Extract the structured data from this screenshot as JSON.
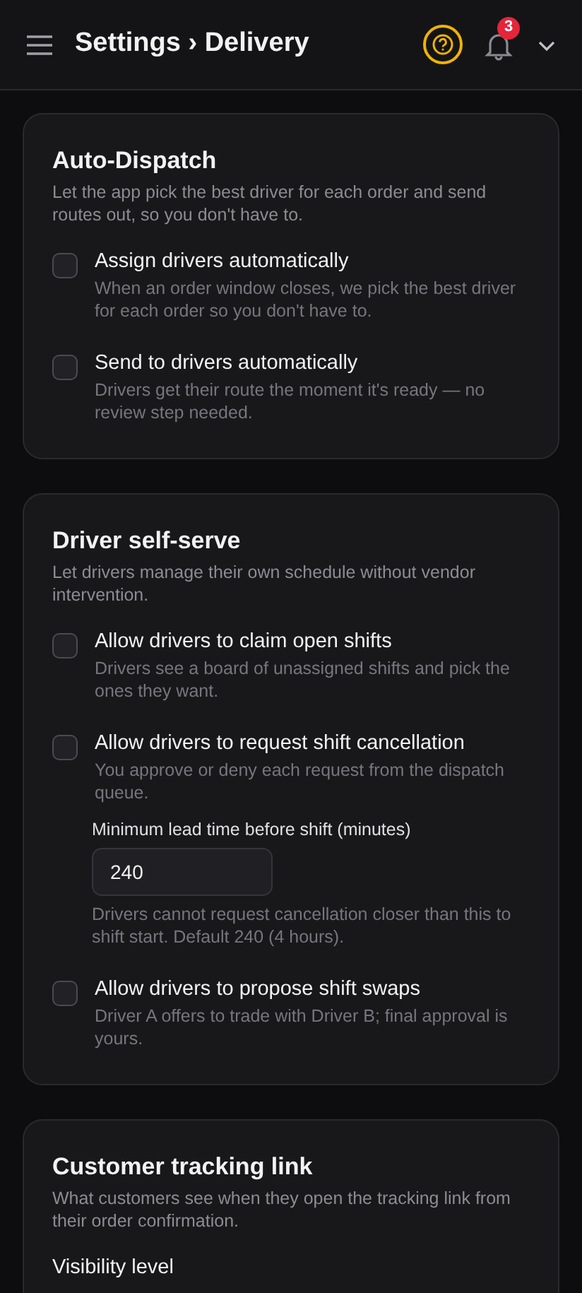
{
  "header": {
    "title": "Settings › Delivery",
    "notification_count": "3"
  },
  "sections": [
    {
      "title": "Auto-Dispatch",
      "description": "Let the app pick the best driver for each order and send routes out, so you don't have to.",
      "items": [
        {
          "kind": "checkbox",
          "label": "Assign drivers automatically",
          "hint": "When an order window closes, we pick the best driver for each order so you don't have to.",
          "checked": false
        },
        {
          "kind": "checkbox",
          "label": "Send to drivers automatically",
          "hint": "Drivers get their route the moment it's ready — no review step needed.",
          "checked": false
        }
      ]
    },
    {
      "title": "Driver self-serve",
      "description": "Let drivers manage their own schedule without vendor intervention.",
      "items": [
        {
          "kind": "checkbox",
          "label": "Allow drivers to claim open shifts",
          "hint": "Drivers see a board of unassigned shifts and pick the ones they want.",
          "checked": false
        },
        {
          "kind": "checkbox",
          "label": "Allow drivers to request shift cancellation",
          "hint": "You approve or deny each request from the dispatch queue.",
          "checked": false
        },
        {
          "kind": "number_field",
          "label": "Minimum lead time before shift (minutes)",
          "value": "240",
          "hint": "Drivers cannot request cancellation closer than this to shift start. Default 240 (4 hours)."
        },
        {
          "kind": "checkbox",
          "label": "Allow drivers to propose shift swaps",
          "hint": "Driver A offers to trade with Driver B; final approval is yours.",
          "checked": false
        }
      ]
    },
    {
      "title": "Customer tracking link",
      "description": "What customers see when they open the tracking link from their order confirmation.",
      "items": [
        {
          "kind": "field_label",
          "label": "Visibility level"
        }
      ]
    }
  ]
}
